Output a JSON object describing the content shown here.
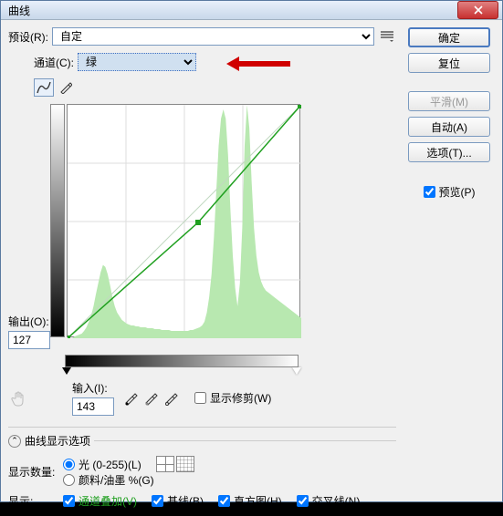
{
  "window": {
    "title": "曲线"
  },
  "preset": {
    "label": "预设(R):",
    "value": "自定"
  },
  "channel": {
    "label": "通道(C):",
    "value": "绿"
  },
  "output": {
    "label": "输出(O):",
    "value": "127"
  },
  "input": {
    "label": "输入(I):",
    "value": "143"
  },
  "show_clipping": {
    "label": "显示修剪(W)",
    "checked": false
  },
  "display_options": {
    "header": "曲线显示选项"
  },
  "amount": {
    "label": "显示数量:",
    "light": {
      "label": "光 (0-255)(L)",
      "checked": true
    },
    "pigment": {
      "label": "颜料/油墨 %(G)",
      "checked": false
    }
  },
  "show": {
    "label": "显示:",
    "overlay": {
      "label": "通道叠加(V)",
      "checked": true
    },
    "baseline": {
      "label": "基线(B)",
      "checked": true
    },
    "histogram": {
      "label": "直方图(H)",
      "checked": true
    },
    "intersection": {
      "label": "交叉线(N)",
      "checked": true
    }
  },
  "buttons": {
    "ok": "确定",
    "reset": "复位",
    "smooth": "平滑(M)",
    "auto": "自动(A)",
    "options": "选项(T)..."
  },
  "preview": {
    "label": "预览(P)",
    "checked": true
  },
  "chart_data": {
    "type": "line",
    "xlabel": "输入",
    "ylabel": "输出",
    "xlim": [
      0,
      255
    ],
    "ylim": [
      0,
      255
    ],
    "series": [
      {
        "name": "curve",
        "points": [
          [
            0,
            0
          ],
          [
            143,
            127
          ],
          [
            255,
            255
          ]
        ]
      },
      {
        "name": "baseline",
        "points": [
          [
            0,
            0
          ],
          [
            255,
            255
          ]
        ]
      }
    ],
    "histogram": [
      0,
      0,
      0,
      2,
      3,
      4,
      5,
      8,
      12,
      18,
      25,
      35,
      48,
      60,
      72,
      80,
      78,
      70,
      58,
      45,
      35,
      28,
      24,
      20,
      18,
      16,
      15,
      14,
      14,
      13,
      13,
      12,
      12,
      12,
      11,
      11,
      11,
      10,
      10,
      10,
      9,
      9,
      9,
      9,
      8,
      8,
      8,
      8,
      8,
      8,
      8,
      8,
      9,
      9,
      10,
      11,
      12,
      14,
      18,
      28,
      45,
      70,
      110,
      160,
      210,
      240,
      250,
      240,
      200,
      140,
      90,
      55,
      35,
      60,
      120,
      210,
      255,
      230,
      170,
      120,
      90,
      72,
      62,
      56,
      52,
      50,
      48,
      46,
      44,
      42,
      40,
      38,
      36,
      34,
      32,
      30,
      28,
      26,
      24,
      22
    ]
  }
}
